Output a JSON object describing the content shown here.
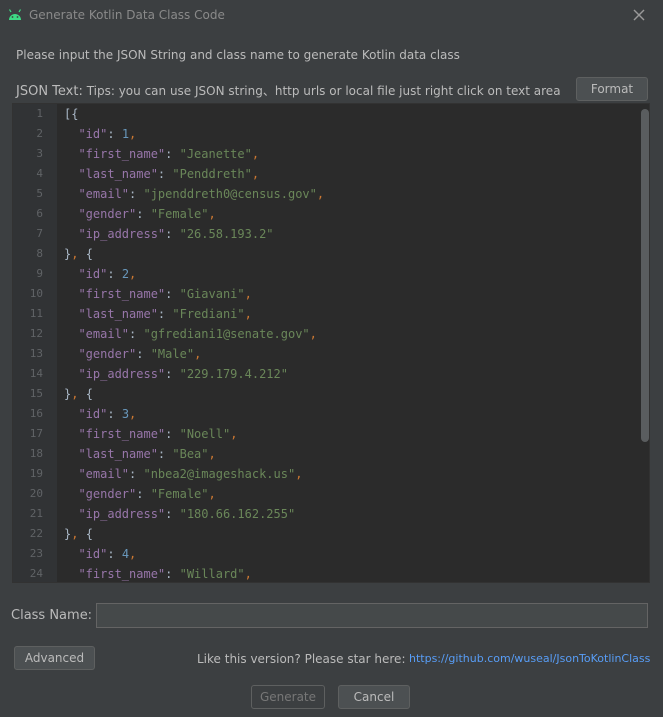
{
  "window": {
    "title": "Generate Kotlin Data Class Code",
    "app_icon": "android-icon",
    "close_icon": "close-icon"
  },
  "instruction": "Please input the JSON String and class name to generate Kotlin data class",
  "json_label": {
    "lead": "JSON Text:",
    "tips": "Tips: you can use JSON string、http urls or local file just right click on text area"
  },
  "format_button": "Format",
  "editor": {
    "lines": [
      [
        "1",
        [
          [
            "b",
            "[{"
          ]
        ]
      ],
      [
        "2",
        [
          [
            "k",
            "  \"id\""
          ],
          [
            "b",
            ": "
          ],
          [
            "n",
            "1"
          ],
          [
            "p",
            ","
          ]
        ]
      ],
      [
        "3",
        [
          [
            "k",
            "  \"first_name\""
          ],
          [
            "b",
            ": "
          ],
          [
            "s",
            "\"Jeanette\""
          ],
          [
            "p",
            ","
          ]
        ]
      ],
      [
        "4",
        [
          [
            "k",
            "  \"last_name\""
          ],
          [
            "b",
            ": "
          ],
          [
            "s",
            "\"Penddreth\""
          ],
          [
            "p",
            ","
          ]
        ]
      ],
      [
        "5",
        [
          [
            "k",
            "  \"email\""
          ],
          [
            "b",
            ": "
          ],
          [
            "s",
            "\"jpenddreth0@census.gov\""
          ],
          [
            "p",
            ","
          ]
        ]
      ],
      [
        "6",
        [
          [
            "k",
            "  \"gender\""
          ],
          [
            "b",
            ": "
          ],
          [
            "s",
            "\"Female\""
          ],
          [
            "p",
            ","
          ]
        ]
      ],
      [
        "7",
        [
          [
            "k",
            "  \"ip_address\""
          ],
          [
            "b",
            ": "
          ],
          [
            "s",
            "\"26.58.193.2\""
          ]
        ]
      ],
      [
        "8",
        [
          [
            "b",
            "}"
          ],
          [
            "p",
            ", "
          ],
          [
            "b",
            "{"
          ]
        ]
      ],
      [
        "9",
        [
          [
            "k",
            "  \"id\""
          ],
          [
            "b",
            ": "
          ],
          [
            "n",
            "2"
          ],
          [
            "p",
            ","
          ]
        ]
      ],
      [
        "10",
        [
          [
            "k",
            "  \"first_name\""
          ],
          [
            "b",
            ": "
          ],
          [
            "s",
            "\"Giavani\""
          ],
          [
            "p",
            ","
          ]
        ]
      ],
      [
        "11",
        [
          [
            "k",
            "  \"last_name\""
          ],
          [
            "b",
            ": "
          ],
          [
            "s",
            "\"Frediani\""
          ],
          [
            "p",
            ","
          ]
        ]
      ],
      [
        "12",
        [
          [
            "k",
            "  \"email\""
          ],
          [
            "b",
            ": "
          ],
          [
            "s",
            "\"gfrediani1@senate.gov\""
          ],
          [
            "p",
            ","
          ]
        ]
      ],
      [
        "13",
        [
          [
            "k",
            "  \"gender\""
          ],
          [
            "b",
            ": "
          ],
          [
            "s",
            "\"Male\""
          ],
          [
            "p",
            ","
          ]
        ]
      ],
      [
        "14",
        [
          [
            "k",
            "  \"ip_address\""
          ],
          [
            "b",
            ": "
          ],
          [
            "s",
            "\"229.179.4.212\""
          ]
        ]
      ],
      [
        "15",
        [
          [
            "b",
            "}"
          ],
          [
            "p",
            ", "
          ],
          [
            "b",
            "{"
          ]
        ]
      ],
      [
        "16",
        [
          [
            "k",
            "  \"id\""
          ],
          [
            "b",
            ": "
          ],
          [
            "n",
            "3"
          ],
          [
            "p",
            ","
          ]
        ]
      ],
      [
        "17",
        [
          [
            "k",
            "  \"first_name\""
          ],
          [
            "b",
            ": "
          ],
          [
            "s",
            "\"Noell\""
          ],
          [
            "p",
            ","
          ]
        ]
      ],
      [
        "18",
        [
          [
            "k",
            "  \"last_name\""
          ],
          [
            "b",
            ": "
          ],
          [
            "s",
            "\"Bea\""
          ],
          [
            "p",
            ","
          ]
        ]
      ],
      [
        "19",
        [
          [
            "k",
            "  \"email\""
          ],
          [
            "b",
            ": "
          ],
          [
            "s",
            "\"nbea2@imageshack.us\""
          ],
          [
            "p",
            ","
          ]
        ]
      ],
      [
        "20",
        [
          [
            "k",
            "  \"gender\""
          ],
          [
            "b",
            ": "
          ],
          [
            "s",
            "\"Female\""
          ],
          [
            "p",
            ","
          ]
        ]
      ],
      [
        "21",
        [
          [
            "k",
            "  \"ip_address\""
          ],
          [
            "b",
            ": "
          ],
          [
            "s",
            "\"180.66.162.255\""
          ]
        ]
      ],
      [
        "22",
        [
          [
            "b",
            "}"
          ],
          [
            "p",
            ", "
          ],
          [
            "b",
            "{"
          ]
        ]
      ],
      [
        "23",
        [
          [
            "k",
            "  \"id\""
          ],
          [
            "b",
            ": "
          ],
          [
            "n",
            "4"
          ],
          [
            "p",
            ","
          ]
        ]
      ],
      [
        "24",
        [
          [
            "k",
            "  \"first_name\""
          ],
          [
            "b",
            ": "
          ],
          [
            "s",
            "\"Willard\""
          ],
          [
            "p",
            ","
          ]
        ]
      ]
    ]
  },
  "class_name": {
    "label": "Class Name:",
    "value": "",
    "placeholder": ""
  },
  "advanced_button": "Advanced",
  "star_text": "Like this version? Please star here:",
  "star_link": "https://github.com/wuseal/JsonToKotlinClass",
  "generate_button": "Generate",
  "cancel_button": "Cancel",
  "colors": {
    "background": "#3c3f41",
    "editor_bg": "#2b2b2b",
    "json_key": "#9876aa",
    "json_string": "#6a8759",
    "json_number": "#6897bb",
    "punctuation": "#cc7832",
    "link": "#589df6",
    "android_green": "#3ddc84"
  }
}
